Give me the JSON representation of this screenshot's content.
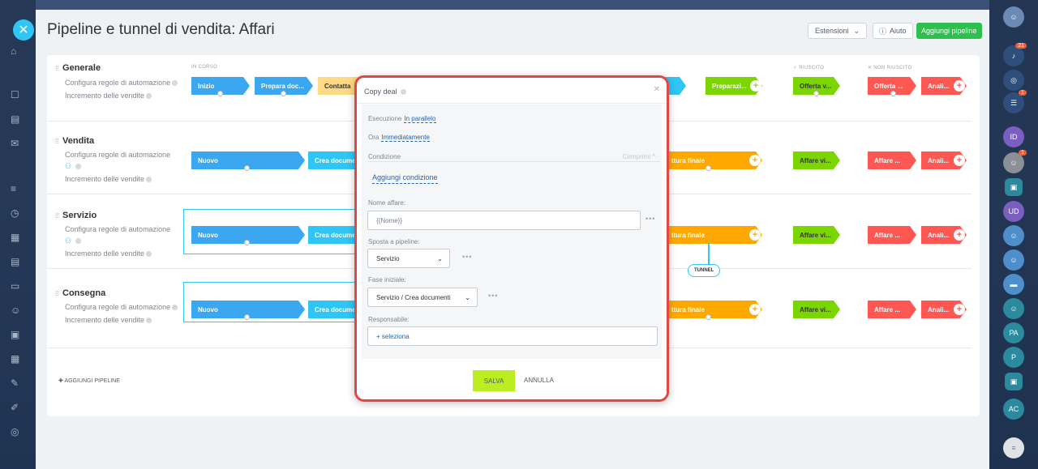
{
  "header": {
    "title": "Pipeline e tunnel di vendita: Affari",
    "extensions": "Estensioni",
    "help": "Aiuto",
    "add_pipeline": "Aggiungi pipeline"
  },
  "columns": {
    "in_progress": "IN CORSO",
    "success": "RIUSCITO",
    "failed": "NON RIUSCITO"
  },
  "pipelines": [
    {
      "title": "Generale",
      "automation": "Configura regole di automazione",
      "sales_increase": "Incremento delle vendite",
      "stages": [
        "Inizio",
        "Prepara doc...",
        "Contatta"
      ],
      "right_stages": [
        "Preparazi...",
        "Offerta v...",
        "Offerta ...",
        "Anali..."
      ]
    },
    {
      "title": "Vendita",
      "automation": "Configura regole di automazione",
      "sales_increase": "Incremento delle vendite",
      "stages": [
        "Nuovo",
        "Crea document"
      ],
      "right_stages": [
        "ttura finale",
        "Affare vi...",
        "Affare ...",
        "Anali..."
      ]
    },
    {
      "title": "Servizio",
      "automation": "Configura regole di automazione",
      "sales_increase": "Incremento delle vendite",
      "stages": [
        "Nuovo",
        "Crea documen"
      ],
      "right_stages": [
        "ttura finale",
        "Affare vi...",
        "Affare ...",
        "Anali..."
      ]
    },
    {
      "title": "Consegna",
      "automation": "Configura regole di automazione",
      "sales_increase": "Incremento delle vendite",
      "stages": [
        "Nuovo",
        "Crea documen"
      ],
      "right_stages": [
        "ttura finale",
        "Affare vi...",
        "Affare ...",
        "Anali..."
      ]
    }
  ],
  "tunnel_label": "TUNNEL",
  "add_pipeline_link": "AGGIUNGI PIPELINE",
  "modal": {
    "title": "Copy deal",
    "execution_label": "Esecuzione",
    "execution_value": "In parallelo",
    "time_label": "Ora",
    "time_value": "Immediatamente",
    "condition_label": "Condizione",
    "collapse": "Comprimi",
    "add_condition": "Aggiungi condizione",
    "deal_name_label": "Nome affare:",
    "deal_name_value": "{{Nome}}",
    "move_pipeline_label": "Sposta a pipeline:",
    "move_pipeline_value": "Servizio",
    "initial_stage_label": "Fase iniziale:",
    "initial_stage_value": "Servizio / Crea documenti",
    "responsible_label": "Responsabile:",
    "responsible_value": "+ seleziona",
    "save": "SALVA",
    "cancel": "ANNULLA"
  },
  "right_rail": {
    "badges": [
      "21",
      "1",
      "1"
    ],
    "avatars": [
      "ID",
      "UD",
      "PA",
      "P",
      "AC"
    ]
  },
  "colors": {
    "blue_stage": "#3ba7f0",
    "cyan_stage": "#2fc6f6",
    "yellow_stage": "#ffd983",
    "orange_stage": "#ffa900",
    "green_stage": "#7bd500",
    "red_stage": "#ff5752",
    "highlight": "#e04848",
    "save_button": "#bbed21"
  }
}
